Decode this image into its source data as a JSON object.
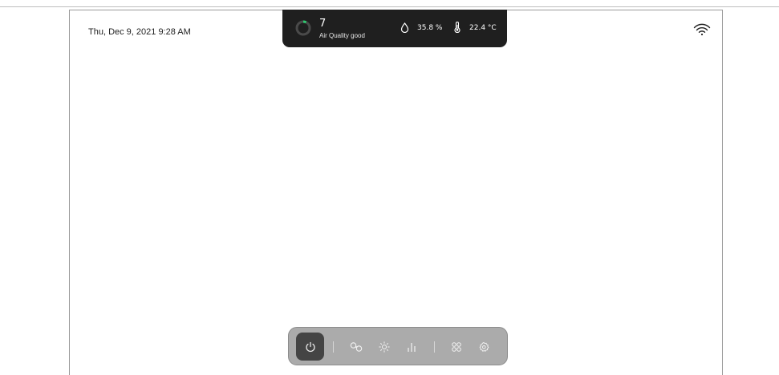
{
  "datetime": "Thu, Dec 9, 2021 9:28 AM",
  "status": {
    "air_quality_value": "7",
    "air_quality_label": "Air Quality good",
    "humidity": "35.8 %",
    "temperature": "22.4 °C"
  },
  "icons": {
    "wifi": "wifi-icon",
    "air_quality": "air-quality-ring-icon",
    "humidity": "droplet-icon",
    "temperature": "thermometer-icon",
    "power": "power-icon",
    "fan": "fan-icon",
    "light": "sun-icon",
    "stats": "bar-chart-icon",
    "apps": "apps-grid-icon",
    "settings": "gear-icon"
  },
  "colors": {
    "status_bg": "#1f1f1f",
    "control_bar_bg": "#ababab",
    "power_active": "#444444",
    "air_quality_accent": "#2ecc71"
  }
}
